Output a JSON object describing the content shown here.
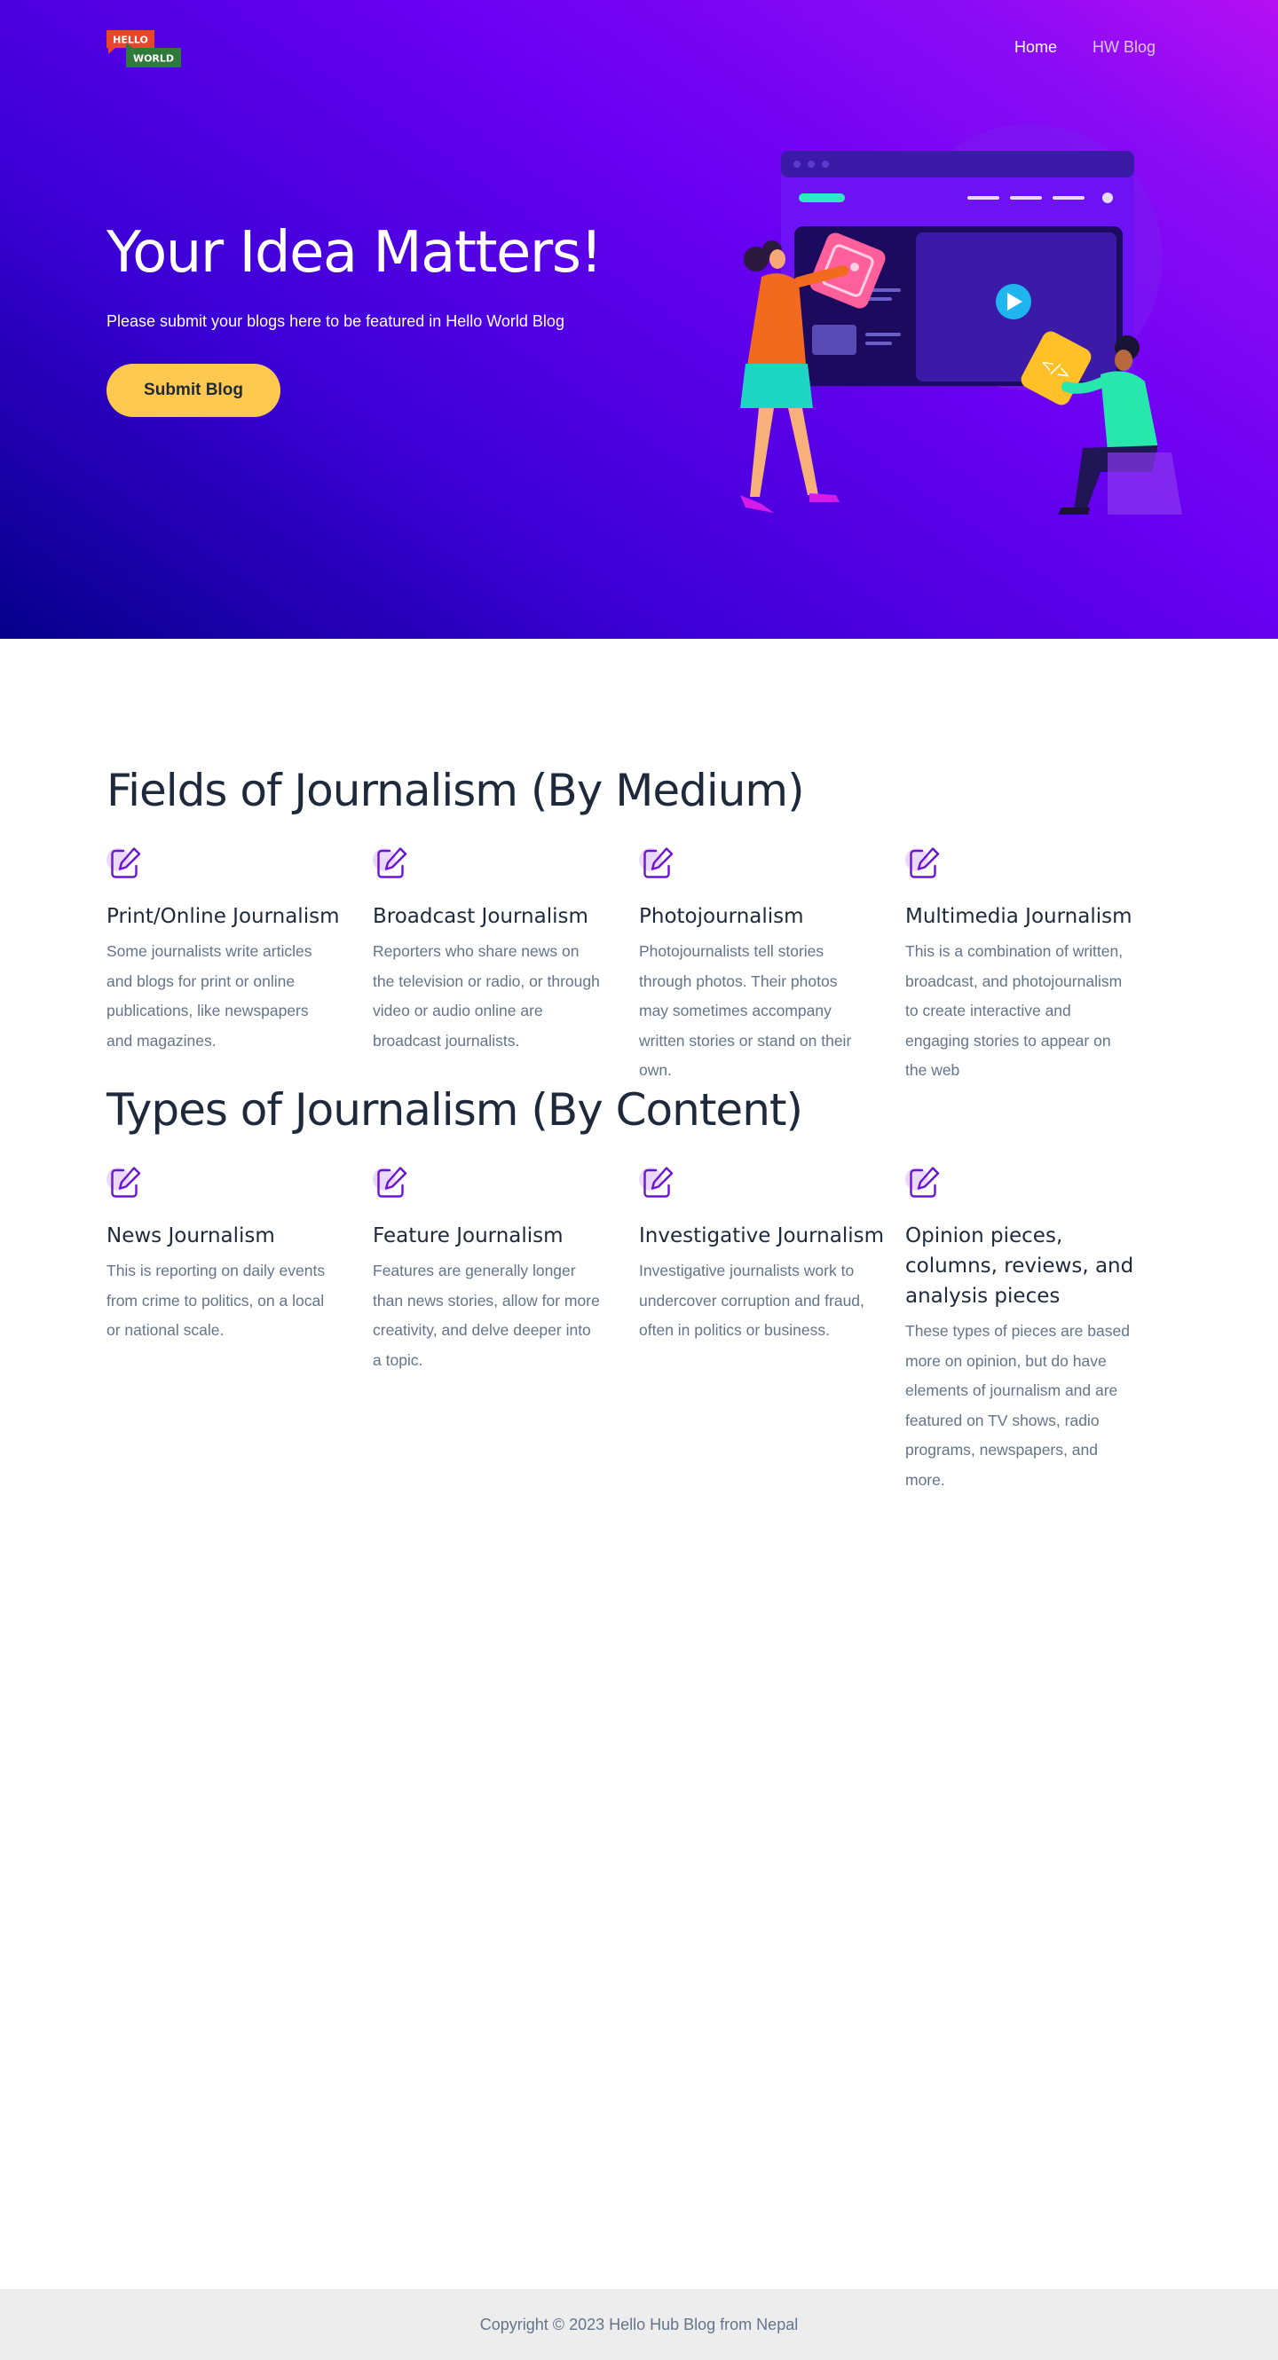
{
  "nav": {
    "logo_text_top": "HELLO",
    "logo_text_bottom": "WORLD",
    "items": [
      {
        "label": "Home",
        "active": true
      },
      {
        "label": "HW Blog",
        "active": false
      }
    ]
  },
  "hero": {
    "title": "Your Idea Matters!",
    "subtitle": "Please submit your blogs here to be featured in Hello World Blog",
    "button_label": "Submit Blog"
  },
  "medium": {
    "title": "Fields of Journalism (By Medium)",
    "cards": [
      {
        "icon": "edit-icon",
        "title": "Print/Online Journalism",
        "text": "Some journalists write articles and blogs for print or online publications, like newspapers and magazines."
      },
      {
        "icon": "edit-icon",
        "title": "Broadcast Journalism",
        "text": "Reporters who share news on the television or radio, or through video or audio online are broadcast journalists."
      },
      {
        "icon": "edit-icon",
        "title": "Photojournalism",
        "text": "Photojournalists tell stories through photos. Their photos may sometimes accompany written stories or stand on their own."
      },
      {
        "icon": "edit-icon",
        "title": "Multimedia Journalism",
        "text": "This is a combination of written, broadcast, and photojournalism to create interactive and engaging stories to appear on the web"
      }
    ]
  },
  "content": {
    "title": "Types of Journalism (By Content)",
    "cards": [
      {
        "icon": "edit-icon",
        "title": "News Journalism",
        "text": "This is reporting on daily events from crime to politics, on a local or national scale."
      },
      {
        "icon": "edit-icon",
        "title": "Feature Journalism",
        "text": "Features are generally longer than news stories, allow for more creativity, and delve deeper into a topic."
      },
      {
        "icon": "edit-icon",
        "title": "Investigative Journalism",
        "text": "Investigative journalists work to undercover corruption and fraud, often in politics or business."
      },
      {
        "icon": "edit-icon",
        "title": "Opinion pieces, columns, reviews, and analysis pieces",
        "text": "These types of pieces are based more on opinion, but do have elements of journalism and are featured on TV shows, radio programs, newspapers, and more."
      }
    ]
  },
  "footer": {
    "copyright": "Copyright © 2023 Hello Hub Blog from Nepal"
  },
  "colors": {
    "hero_gradient_start": "#06008a",
    "hero_gradient_end": "#b40ff2",
    "button": "#ffc94f",
    "icon_stroke": "#6b12d9",
    "icon_bg": "#ead9fa"
  }
}
